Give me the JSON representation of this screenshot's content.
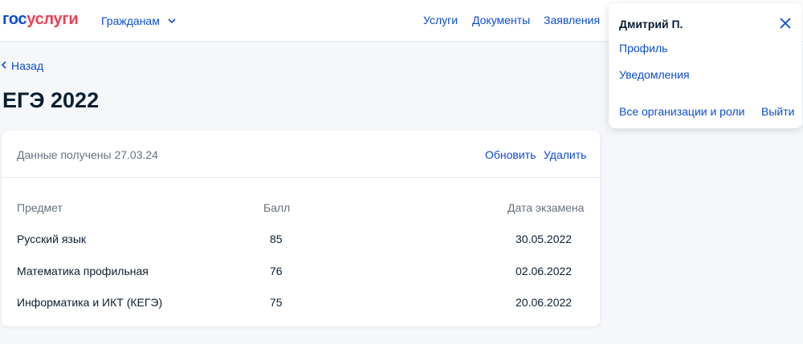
{
  "header": {
    "logo_part1": "гос",
    "logo_part2": "услуги",
    "citizens_label": "Гражданам",
    "nav": [
      "Услуги",
      "Документы",
      "Заявления"
    ]
  },
  "back_label": "Назад",
  "page_title": "ЕГЭ 2022",
  "card": {
    "received_label": "Данные получены 27.03.24",
    "refresh_label": "Обновить",
    "delete_label": "Удалить",
    "columns": [
      "Предмет",
      "Балл",
      "Дата экзамена"
    ],
    "rows": [
      {
        "subject": "Русский язык",
        "score": "85",
        "date": "30.05.2022"
      },
      {
        "subject": "Математика профильная",
        "score": "76",
        "date": "02.06.2022"
      },
      {
        "subject": "Информатика и ИКТ (КЕГЭ)",
        "score": "75",
        "date": "20.06.2022"
      }
    ]
  },
  "profile_menu": {
    "user_name": "Дмитрий П.",
    "profile_label": "Профиль",
    "notifications_label": "Уведомления",
    "orgs_label": "Все организации и роли",
    "logout_label": "Выйти"
  },
  "colors": {
    "accent": "#0d4cd3",
    "brand_red": "#ee3f58",
    "text": "#0b1f33",
    "muted": "#66727f",
    "background": "#f5f7fa"
  },
  "icons": [
    "chevron-down-icon",
    "chevron-left-icon",
    "close-icon"
  ]
}
